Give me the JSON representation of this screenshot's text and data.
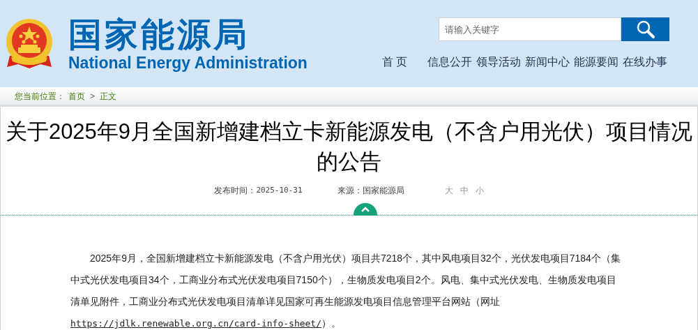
{
  "header": {
    "logo_cn": "国家能源局",
    "logo_en": "National Energy Administration",
    "search": {
      "placeholder": "请输入关键字"
    },
    "nav": [
      "首 页",
      "信息公开",
      "领导活动",
      "新闻中心",
      "能源要闻",
      "在线办事"
    ]
  },
  "breadcrumb": {
    "label": "您当前位置：",
    "items": [
      "首页",
      "正文"
    ],
    "separator": ">"
  },
  "article": {
    "title": "关于2025年9月全国新增建档立卡新能源发电（不含户用光伏）项目情况的公告",
    "meta": {
      "date_label": "发布时间：",
      "date": "2025-10-31",
      "source_label": "来源：",
      "source": "国家能源局",
      "font_sizes": [
        "大",
        "中",
        "小"
      ]
    },
    "paragraph": {
      "text": "2025年9月，全国新增建档立卡新能源发电（不含户用光伏）项目共7218个，其中风电项目32个，光伏发电项目7184个（集中式光伏发电项目34个，工商业分布式光伏发电项目7150个），生物质发电项目2个。风电、集中式光伏发电、生物质发电项目清单见附件，工商业分布式光伏发电项目清单详见国家可再生能源发电项目信息管理平台网站（网址",
      "link": "https://jdlk.renewable.org.cn/card-info-sheet/",
      "after": "）。"
    }
  }
}
